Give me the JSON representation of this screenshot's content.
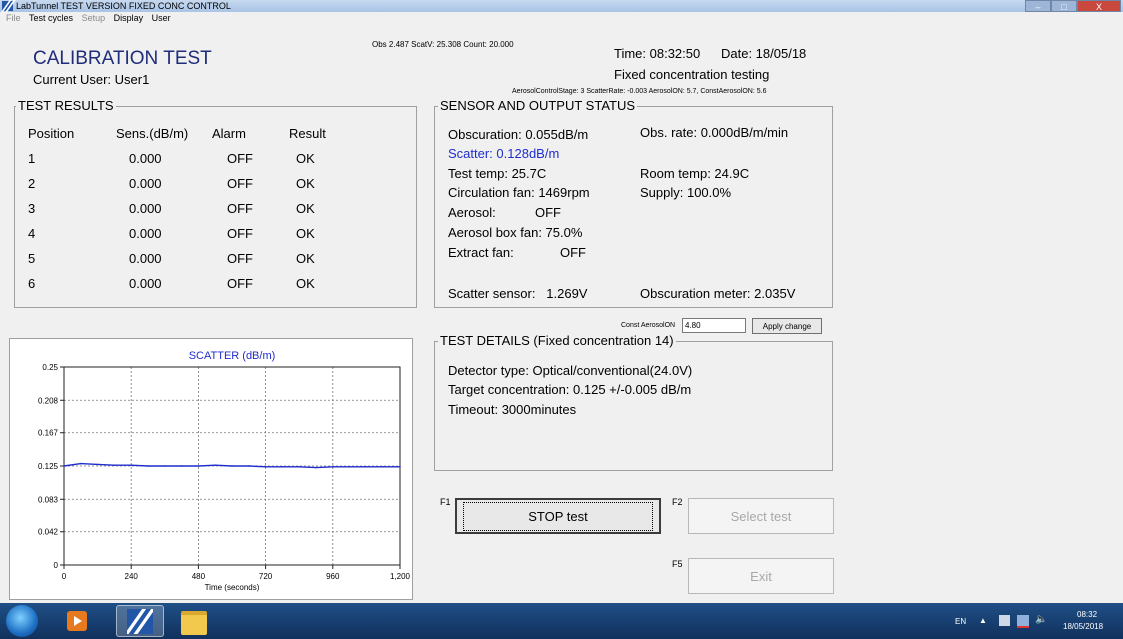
{
  "window": {
    "title": "LabTunnel  TEST VERSION FIXED CONC CONTROL",
    "min": "–",
    "max": "□",
    "close": "X"
  },
  "menu": [
    {
      "label": "File",
      "enabled": false
    },
    {
      "label": "Test cycles",
      "enabled": true
    },
    {
      "label": "Setup",
      "enabled": false
    },
    {
      "label": "Display",
      "enabled": true
    },
    {
      "label": "User",
      "enabled": true
    }
  ],
  "header": {
    "title": "CALIBRATION TEST",
    "current_user": "Current User: User1",
    "obs_line": "Obs 2.487 ScatV: 25.308 Count: 20.000",
    "time": "Time: 08:32:50",
    "date": "Date: 18/05/18",
    "mode": "Fixed concentration testing",
    "aerosol_line": "AerosolControlStage: 3 ScatterRate: -0.003  AerosolON: 5.7, ConstAerosolON: 5.6"
  },
  "results": {
    "legend": "TEST RESULTS",
    "columns": [
      "Position",
      "Sens.(dB/m)",
      "Alarm",
      "Result"
    ],
    "rows": [
      [
        "1",
        "0.000",
        "OFF",
        "OK"
      ],
      [
        "2",
        "0.000",
        "OFF",
        "OK"
      ],
      [
        "3",
        "0.000",
        "OFF",
        "OK"
      ],
      [
        "4",
        "0.000",
        "OFF",
        "OK"
      ],
      [
        "5",
        "0.000",
        "OFF",
        "OK"
      ],
      [
        "6",
        "0.000",
        "OFF",
        "OK"
      ]
    ]
  },
  "sensor": {
    "legend": "SENSOR AND OUTPUT STATUS",
    "obscuration": "Obscuration: 0.055dB/m",
    "obs_rate": "Obs. rate: 0.000dB/m/min",
    "scatter": "Scatter: 0.128dB/m",
    "test_temp": "Test temp: 25.7C",
    "room_temp": "Room temp: 24.9C",
    "circ_fan": "Circulation fan: 1469rpm",
    "supply": "Supply: 100.0%",
    "aerosol_label": "Aerosol:",
    "aerosol_value": "OFF",
    "aerosol_box_fan": "Aerosol box fan: 75.0%",
    "extract_label": "Extract fan:",
    "extract_value": "OFF",
    "scatter_sensor": "Scatter sensor:   1.269V",
    "obs_meter": "Obscuration meter: 2.035V",
    "scatter_color": "#1f2dcc"
  },
  "const_aerosol": {
    "label": "Const AerosolON",
    "value": "4.80",
    "apply": "Apply change"
  },
  "details": {
    "legend": "TEST DETAILS (Fixed concentration 14)",
    "detector": "Detector type: Optical/conventional(24.0V)",
    "target": "Target concentration: 0.125 +/-0.005 dB/m",
    "timeout": "Timeout: 3000minutes"
  },
  "buttons": {
    "f1": "F1",
    "stop": "STOP test",
    "f2": "F2",
    "select": "Select test",
    "f5": "F5",
    "exit": "Exit"
  },
  "taskbar": {
    "lang": "EN",
    "time": "08:32",
    "date": "18/05/2018",
    "tray_arrow": "▲",
    "speaker": "🔈"
  },
  "chart_data": {
    "type": "line",
    "title": "SCATTER (dB/m)",
    "xlabel": "Time (seconds)",
    "ylabel": "",
    "xlim": [
      0,
      1200
    ],
    "ylim": [
      0,
      0.25
    ],
    "xticks": [
      0,
      240,
      480,
      720,
      960,
      1200
    ],
    "xtick_labels": [
      "0",
      "240",
      "480",
      "720",
      "960",
      "1,200"
    ],
    "yticks": [
      0,
      0.042,
      0.083,
      0.125,
      0.167,
      0.208,
      0.25
    ],
    "ytick_labels": [
      "0",
      "0.042",
      "0.083",
      "0.125",
      "0.167",
      "0.208",
      "0.25"
    ],
    "grid": true,
    "line_color": "#1f2dcc",
    "series": [
      {
        "x": [
          0,
          60,
          120,
          180,
          240,
          300,
          360,
          420,
          480,
          540,
          600,
          660,
          720,
          780,
          840,
          900,
          960,
          1020,
          1080,
          1140,
          1200
        ],
        "values": [
          0.125,
          0.128,
          0.127,
          0.126,
          0.126,
          0.125,
          0.125,
          0.125,
          0.125,
          0.126,
          0.125,
          0.125,
          0.124,
          0.124,
          0.124,
          0.123,
          0.124,
          0.124,
          0.124,
          0.124,
          0.124
        ]
      }
    ]
  }
}
